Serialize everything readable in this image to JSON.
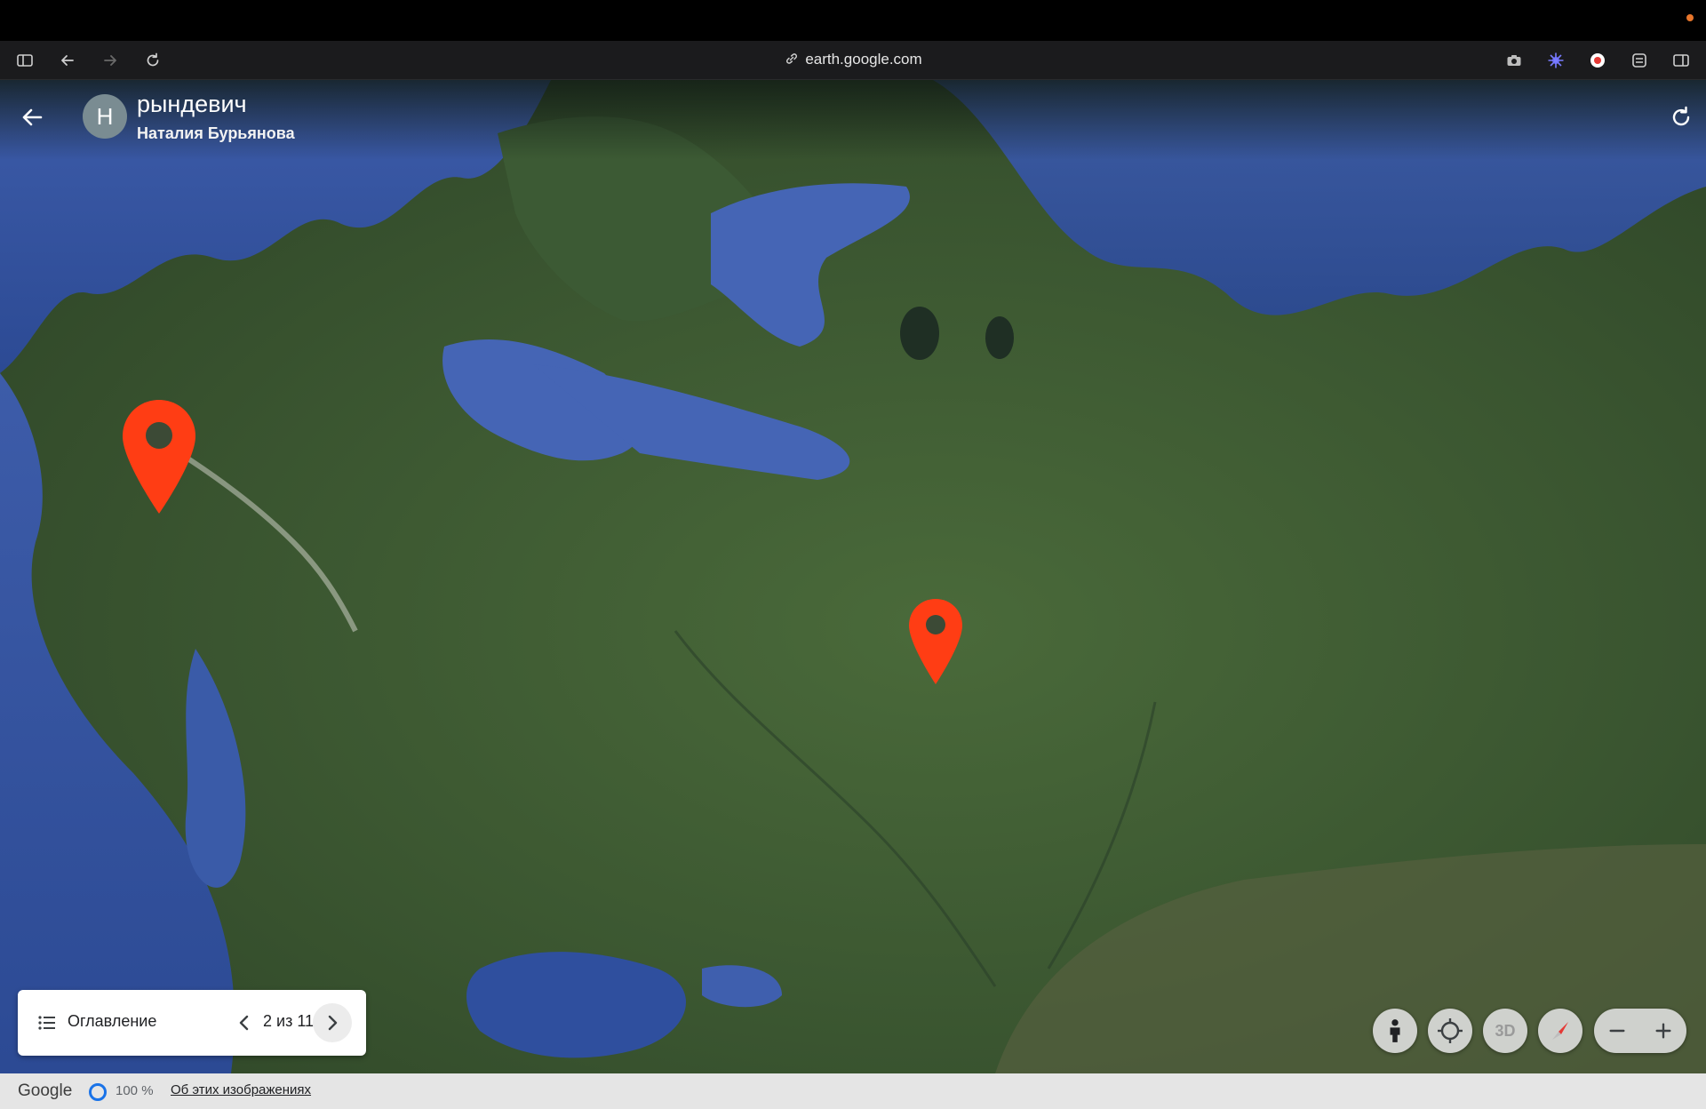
{
  "browser": {
    "url": "earth.google.com",
    "icons": [
      "sidebar-icon",
      "back-icon",
      "forward-icon",
      "reload-icon",
      "camera-icon",
      "extension-icon",
      "record-icon",
      "settings-icon",
      "split-view-icon"
    ]
  },
  "project": {
    "avatar_initial": "Н",
    "title": "рындевич",
    "author": "Наталия Бурьянова"
  },
  "toc": {
    "label": "Оглавление",
    "counter": "2 из 11"
  },
  "controls": {
    "three_d_label": "3D",
    "icons": [
      "pegman-icon",
      "my-location-icon",
      "compass-icon",
      "zoom-out-icon",
      "zoom-in-icon"
    ]
  },
  "status": {
    "google_label": "Google",
    "load_percent": "100 %",
    "about_link": "Об этих изображениях"
  },
  "colors": {
    "pin": "#ff3d14",
    "land": "#3e5a33",
    "water": "#3f5fae"
  }
}
